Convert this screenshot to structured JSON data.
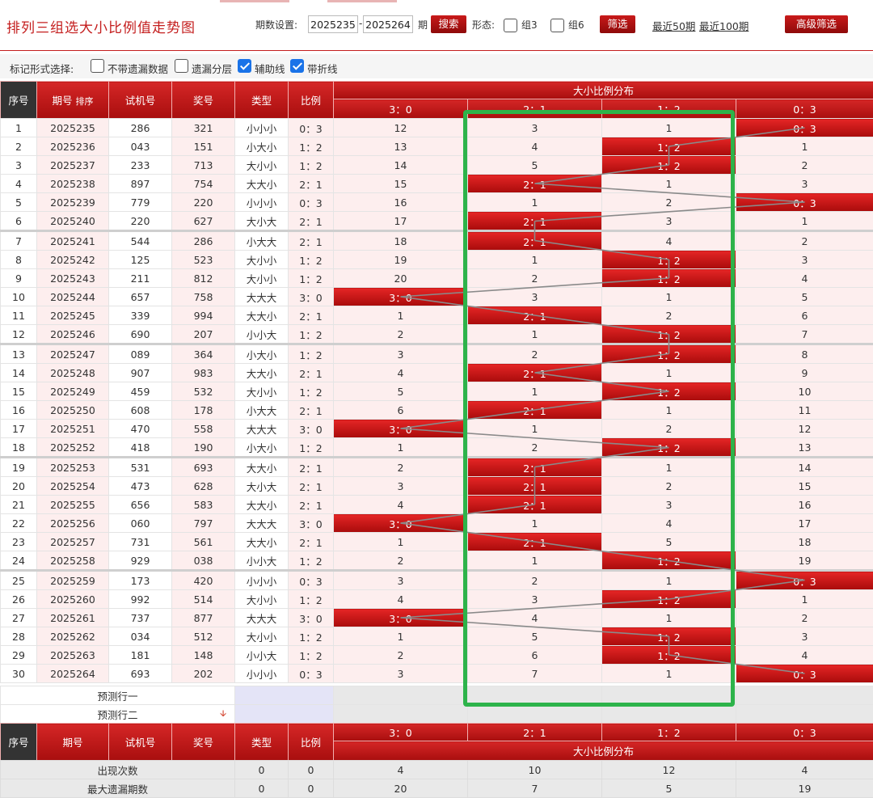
{
  "header": {
    "title": "排列三组选大小比例值走势图",
    "period_label": "期数设置:",
    "period_start": "2025235",
    "dash": "-",
    "period_end": "2025264",
    "period_unit": "期",
    "search_button": "搜索",
    "form_label": "形态:",
    "group3_label": "组3",
    "group6_label": "组6",
    "filter_button": "筛选",
    "recent50": "最近50期",
    "recent100": "最近100期",
    "advanced_button": "高级筛选"
  },
  "mark_options": {
    "label": "标记形式选择:",
    "options": [
      {
        "label": "不带遗漏数据",
        "checked": false
      },
      {
        "label": "遗漏分层",
        "checked": false
      },
      {
        "label": "辅助线",
        "checked": true
      },
      {
        "label": "带折线",
        "checked": true
      }
    ]
  },
  "table_header": {
    "seq": "序号",
    "period": "期号",
    "sort": "排序",
    "trial": "试机号",
    "prize": "奖号",
    "type": "类型",
    "ratio": "比例",
    "dist_title": "大小比例分布",
    "dist_cols": [
      "3：0",
      "2：1",
      "1：2",
      "0：3"
    ]
  },
  "rows": [
    {
      "seq": "1",
      "period": "2025235",
      "trial": "286",
      "prize": "321",
      "type": "小小小",
      "ratio": "0：3",
      "dist": [
        "12",
        "3",
        "1",
        "0：3"
      ],
      "hit": 3
    },
    {
      "seq": "2",
      "period": "2025236",
      "trial": "043",
      "prize": "151",
      "type": "小大小",
      "ratio": "1：2",
      "dist": [
        "13",
        "4",
        "1：2",
        "1"
      ],
      "hit": 2
    },
    {
      "seq": "3",
      "period": "2025237",
      "trial": "233",
      "prize": "713",
      "type": "大小小",
      "ratio": "1：2",
      "dist": [
        "14",
        "5",
        "1：2",
        "2"
      ],
      "hit": 2
    },
    {
      "seq": "4",
      "period": "2025238",
      "trial": "897",
      "prize": "754",
      "type": "大大小",
      "ratio": "2：1",
      "dist": [
        "15",
        "2：1",
        "1",
        "3"
      ],
      "hit": 1
    },
    {
      "seq": "5",
      "period": "2025239",
      "trial": "779",
      "prize": "220",
      "type": "小小小",
      "ratio": "0：3",
      "dist": [
        "16",
        "1",
        "2",
        "0：3"
      ],
      "hit": 3
    },
    {
      "seq": "6",
      "period": "2025240",
      "trial": "220",
      "prize": "627",
      "type": "大小大",
      "ratio": "2：1",
      "dist": [
        "17",
        "2：1",
        "3",
        "1"
      ],
      "hit": 1
    },
    {
      "seq": "7",
      "period": "2025241",
      "trial": "544",
      "prize": "286",
      "type": "小大大",
      "ratio": "2：1",
      "dist": [
        "18",
        "2：1",
        "4",
        "2"
      ],
      "hit": 1
    },
    {
      "seq": "8",
      "period": "2025242",
      "trial": "125",
      "prize": "523",
      "type": "大小小",
      "ratio": "1：2",
      "dist": [
        "19",
        "1",
        "1：2",
        "3"
      ],
      "hit": 2
    },
    {
      "seq": "9",
      "period": "2025243",
      "trial": "211",
      "prize": "812",
      "type": "大小小",
      "ratio": "1：2",
      "dist": [
        "20",
        "2",
        "1：2",
        "4"
      ],
      "hit": 2
    },
    {
      "seq": "10",
      "period": "2025244",
      "trial": "657",
      "prize": "758",
      "type": "大大大",
      "ratio": "3：0",
      "dist": [
        "3：0",
        "3",
        "1",
        "5"
      ],
      "hit": 0
    },
    {
      "seq": "11",
      "period": "2025245",
      "trial": "339",
      "prize": "994",
      "type": "大大小",
      "ratio": "2：1",
      "dist": [
        "1",
        "2：1",
        "2",
        "6"
      ],
      "hit": 1
    },
    {
      "seq": "12",
      "period": "2025246",
      "trial": "690",
      "prize": "207",
      "type": "小小大",
      "ratio": "1：2",
      "dist": [
        "2",
        "1",
        "1：2",
        "7"
      ],
      "hit": 2
    },
    {
      "seq": "13",
      "period": "2025247",
      "trial": "089",
      "prize": "364",
      "type": "小大小",
      "ratio": "1：2",
      "dist": [
        "3",
        "2",
        "1：2",
        "8"
      ],
      "hit": 2
    },
    {
      "seq": "14",
      "period": "2025248",
      "trial": "907",
      "prize": "983",
      "type": "大大小",
      "ratio": "2：1",
      "dist": [
        "4",
        "2：1",
        "1",
        "9"
      ],
      "hit": 1
    },
    {
      "seq": "15",
      "period": "2025249",
      "trial": "459",
      "prize": "532",
      "type": "大小小",
      "ratio": "1：2",
      "dist": [
        "5",
        "1",
        "1：2",
        "10"
      ],
      "hit": 2
    },
    {
      "seq": "16",
      "period": "2025250",
      "trial": "608",
      "prize": "178",
      "type": "小大大",
      "ratio": "2：1",
      "dist": [
        "6",
        "2：1",
        "1",
        "11"
      ],
      "hit": 1
    },
    {
      "seq": "17",
      "period": "2025251",
      "trial": "470",
      "prize": "558",
      "type": "大大大",
      "ratio": "3：0",
      "dist": [
        "3：0",
        "1",
        "2",
        "12"
      ],
      "hit": 0
    },
    {
      "seq": "18",
      "period": "2025252",
      "trial": "418",
      "prize": "190",
      "type": "小大小",
      "ratio": "1：2",
      "dist": [
        "1",
        "2",
        "1：2",
        "13"
      ],
      "hit": 2
    },
    {
      "seq": "19",
      "period": "2025253",
      "trial": "531",
      "prize": "693",
      "type": "大大小",
      "ratio": "2：1",
      "dist": [
        "2",
        "2：1",
        "1",
        "14"
      ],
      "hit": 1
    },
    {
      "seq": "20",
      "period": "2025254",
      "trial": "473",
      "prize": "628",
      "type": "大小大",
      "ratio": "2：1",
      "dist": [
        "3",
        "2：1",
        "2",
        "15"
      ],
      "hit": 1
    },
    {
      "seq": "21",
      "period": "2025255",
      "trial": "656",
      "prize": "583",
      "type": "大大小",
      "ratio": "2：1",
      "dist": [
        "4",
        "2：1",
        "3",
        "16"
      ],
      "hit": 1
    },
    {
      "seq": "22",
      "period": "2025256",
      "trial": "060",
      "prize": "797",
      "type": "大大大",
      "ratio": "3：0",
      "dist": [
        "3：0",
        "1",
        "4",
        "17"
      ],
      "hit": 0
    },
    {
      "seq": "23",
      "period": "2025257",
      "trial": "731",
      "prize": "561",
      "type": "大大小",
      "ratio": "2：1",
      "dist": [
        "1",
        "2：1",
        "5",
        "18"
      ],
      "hit": 1
    },
    {
      "seq": "24",
      "period": "2025258",
      "trial": "929",
      "prize": "038",
      "type": "小小大",
      "ratio": "1：2",
      "dist": [
        "2",
        "1",
        "1：2",
        "19"
      ],
      "hit": 2
    },
    {
      "seq": "25",
      "period": "2025259",
      "trial": "173",
      "prize": "420",
      "type": "小小小",
      "ratio": "0：3",
      "dist": [
        "3",
        "2",
        "1",
        "0：3"
      ],
      "hit": 3
    },
    {
      "seq": "26",
      "period": "2025260",
      "trial": "992",
      "prize": "514",
      "type": "大小小",
      "ratio": "1：2",
      "dist": [
        "4",
        "3",
        "1：2",
        "1"
      ],
      "hit": 2
    },
    {
      "seq": "27",
      "period": "2025261",
      "trial": "737",
      "prize": "877",
      "type": "大大大",
      "ratio": "3：0",
      "dist": [
        "3：0",
        "4",
        "1",
        "2"
      ],
      "hit": 0
    },
    {
      "seq": "28",
      "period": "2025262",
      "trial": "034",
      "prize": "512",
      "type": "大小小",
      "ratio": "1：2",
      "dist": [
        "1",
        "5",
        "1：2",
        "3"
      ],
      "hit": 2
    },
    {
      "seq": "29",
      "period": "2025263",
      "trial": "181",
      "prize": "148",
      "type": "小小大",
      "ratio": "1：2",
      "dist": [
        "2",
        "6",
        "1：2",
        "4"
      ],
      "hit": 2
    },
    {
      "seq": "30",
      "period": "2025264",
      "trial": "693",
      "prize": "202",
      "type": "小小小",
      "ratio": "0：3",
      "dist": [
        "3",
        "7",
        "1",
        "0：3"
      ],
      "hit": 3
    }
  ],
  "predict": {
    "row1": "预测行一",
    "row2": "预测行二"
  },
  "stats": [
    {
      "label": "出现次数",
      "type": "0",
      "ratio": "0",
      "dist": [
        "4",
        "10",
        "12",
        "4"
      ]
    },
    {
      "label": "最大遗漏期数",
      "type": "0",
      "ratio": "0",
      "dist": [
        "20",
        "7",
        "5",
        "19"
      ]
    }
  ],
  "colors": {
    "accent": "#c41e1e",
    "highlight_box": "#2db34a",
    "checkbox_on": "#1a73e8"
  }
}
